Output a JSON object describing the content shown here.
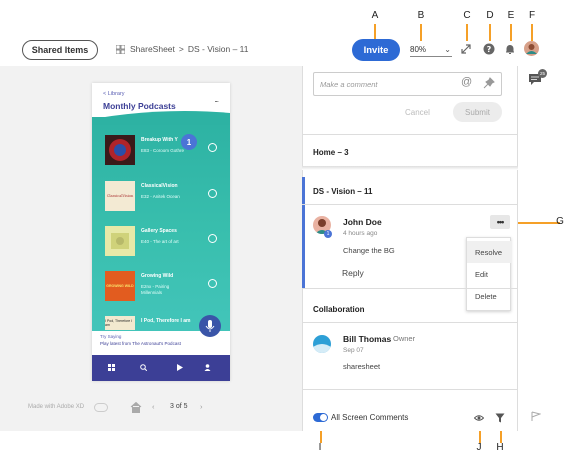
{
  "callouts": [
    "A",
    "B",
    "C",
    "D",
    "E",
    "F",
    "G",
    "H",
    "I",
    "J"
  ],
  "header": {
    "shared_items_label": "Shared Items",
    "breadcrumb": [
      "ShareSheet",
      ">",
      "DS - Vision – 11"
    ],
    "invite_label": "Invite",
    "zoom_value": "80%"
  },
  "phone": {
    "back_label": "< Library",
    "title": "Monthly Podcasts",
    "more_label": "...",
    "badge_count": "1",
    "items": [
      {
        "title": "Breakup With Y",
        "sub": "E83 - Coroom Gothre"
      },
      {
        "title": "ClassicalVision",
        "sub": "E32 - Anitek Ocean"
      },
      {
        "title": "Gallery Spaces",
        "sub": "E40 - The art of art"
      },
      {
        "title": "Growing Wild",
        "sub": "E2nx - Pairing Millennials"
      },
      {
        "title": "I Pod, Therefore I am",
        "sub": ""
      }
    ],
    "thumb_labels": [
      "",
      "ClassicalVision",
      "",
      "GROWING WILD",
      "I Pod, Therefore I am"
    ],
    "try_saying": "Try Saying",
    "play_latest": "Play latest from The Astronaut's Podcast"
  },
  "canvas": {
    "made_with": "Made with Adobe XD",
    "page_counter": "3 of 5"
  },
  "comments": {
    "placeholder": "Make a comment",
    "at_symbol": "@",
    "cancel_label": "Cancel",
    "submit_label": "Submit",
    "home_section": "Home – 3",
    "current_section": "DS - Vision – 11",
    "thread": {
      "author": "John Doe",
      "time": "4 hours ago",
      "text": "Change the BG",
      "reply_label": "Reply",
      "badge": "1",
      "more_label": "•••"
    },
    "menu": [
      "Resolve",
      "Edit",
      "Delete"
    ],
    "collab_section": "Collaboration",
    "collab": {
      "author": "Bill Thomas",
      "role": "Owner",
      "date": "Sep 07",
      "text": "sharesheet"
    },
    "all_screen_label": "All Screen Comments"
  },
  "right_rail": {
    "chat_badge": "25"
  },
  "colors": {
    "accent": "#2d6ad5",
    "callout": "#f5a028",
    "podcast_green": "#39bfae",
    "podcast_nav": "#3c3f96"
  }
}
